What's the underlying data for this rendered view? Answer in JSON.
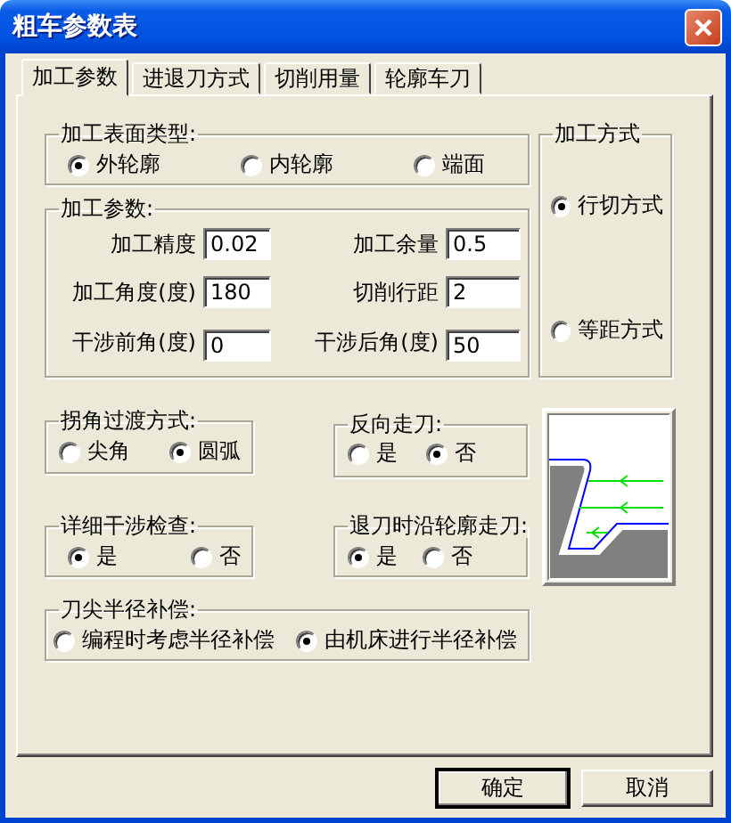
{
  "window": {
    "title": "粗车参数表"
  },
  "tabs": [
    {
      "label": "加工参数",
      "selected": true
    },
    {
      "label": "进退刀方式",
      "selected": false
    },
    {
      "label": "切削用量",
      "selected": false
    },
    {
      "label": "轮廓车刀",
      "selected": false
    }
  ],
  "surface_type": {
    "title": "加工表面类型:",
    "options": [
      {
        "label": "外轮廓",
        "selected": true
      },
      {
        "label": "内轮廓",
        "selected": false
      },
      {
        "label": "端面",
        "selected": false
      }
    ]
  },
  "parameters": {
    "title": "加工参数:",
    "fields": [
      {
        "label": "加工精度",
        "value": "0.02"
      },
      {
        "label": "加工余量",
        "value": "0.5"
      },
      {
        "label": "加工角度(度)",
        "value": "180"
      },
      {
        "label": "切削行距",
        "value": "2"
      },
      {
        "label": "干涉前角(度)",
        "value": "0"
      },
      {
        "label": "干涉后角(度)",
        "value": "50"
      }
    ]
  },
  "machining_method": {
    "title": "加工方式",
    "options": [
      {
        "label": "行切方式",
        "selected": true
      },
      {
        "label": "等距方式",
        "selected": false
      }
    ]
  },
  "corner_transition": {
    "title": "拐角过渡方式:",
    "options": [
      {
        "label": "尖角",
        "selected": false
      },
      {
        "label": "圆弧",
        "selected": true
      }
    ]
  },
  "reverse_feed": {
    "title": "反向走刀:",
    "options": [
      {
        "label": "是",
        "selected": false
      },
      {
        "label": "否",
        "selected": true
      }
    ]
  },
  "interference_check": {
    "title": "详细干涉检查:",
    "options": [
      {
        "label": "是",
        "selected": true
      },
      {
        "label": "否",
        "selected": false
      }
    ]
  },
  "retract_along_contour": {
    "title": "退刀时沿轮廓走刀:",
    "options": [
      {
        "label": "是",
        "selected": true
      },
      {
        "label": "否",
        "selected": false
      }
    ]
  },
  "nose_radius_compensation": {
    "title": "刀尖半径补偿:",
    "options": [
      {
        "label": "编程时考虑半径补偿",
        "selected": false
      },
      {
        "label": "由机床进行半径补偿",
        "selected": true
      }
    ]
  },
  "buttons": [
    {
      "label": "确定",
      "default": true
    },
    {
      "label": "取消",
      "default": false
    }
  ]
}
